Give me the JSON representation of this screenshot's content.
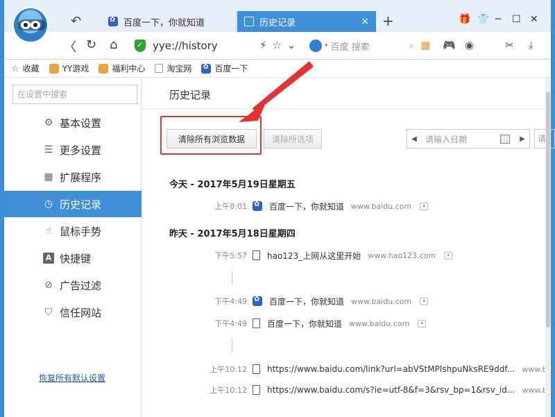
{
  "tabs": [
    {
      "title": "百度一下，你就知道",
      "icon": "baidu-paw-icon"
    },
    {
      "title": "历史记录",
      "icon": "page-icon",
      "close": "×"
    }
  ],
  "new_tab": "+",
  "window_controls": [
    "─",
    "☐",
    "✕"
  ],
  "title_icons": [
    "🎁",
    "👕"
  ],
  "nav": {
    "back": "〈",
    "refresh": "↻",
    "home": "⌂",
    "url": "yye://history",
    "undo": "↶"
  },
  "addr_icons": "⚡☆⌄",
  "search": {
    "placeholder": "百度 搜索",
    "dropdown": "▾"
  },
  "toolbar_icons": [
    "▦",
    "🎮",
    "◉",
    "✂",
    "⤓"
  ],
  "bookmarks": [
    {
      "label": "收藏",
      "icon": "star-icon"
    },
    {
      "label": "YY游戏",
      "icon": "tiger-icon"
    },
    {
      "label": "福利中心",
      "icon": "tiger-icon"
    },
    {
      "label": "淘宝网",
      "icon": "page-icon"
    },
    {
      "label": "百度一下",
      "icon": "baidu-paw-icon"
    }
  ],
  "sidebar": {
    "search_placeholder": "在设置中搜索",
    "items": [
      {
        "label": "基本设置",
        "icon": "⚙"
      },
      {
        "label": "更多设置",
        "icon": "☰"
      },
      {
        "label": "扩展程序",
        "icon": "▦"
      },
      {
        "label": "历史记录",
        "icon": "◷",
        "active": true
      },
      {
        "label": "鼠标手势",
        "icon": "☝"
      },
      {
        "label": "快捷键",
        "icon": "A"
      },
      {
        "label": "广告过滤",
        "icon": "⊘"
      },
      {
        "label": "信任网站",
        "icon": "⛉"
      }
    ],
    "restore_link": "恢复所有默认设置"
  },
  "main": {
    "title": "历史记录",
    "clear_all_button": "清除所有浏览数据",
    "clear_selected_button": "清除所选项",
    "date_placeholder": "请输入日期",
    "date_cut": "请",
    "arrow_left": "◀",
    "arrow_right": "▶",
    "dropdown_glyph": "▾",
    "days": [
      {
        "heading": "今天 - 2017年5月19日星期五",
        "entries": [
          {
            "time": "上午8:01",
            "title": "百度一下，你就知道",
            "domain": "www.baidu.com",
            "icon": "baidu-paw-icon"
          }
        ]
      },
      {
        "heading": "昨天 - 2017年5月18日星期四",
        "entries": [
          {
            "time": "下午5:57",
            "title": "hao123_上网从这里开始",
            "domain": "www.hao123.com",
            "icon": "page-icon"
          },
          {
            "time": "下午4:49",
            "title": "百度一下，你就知道",
            "domain": "www.baidu.com",
            "icon": "baidu-paw-icon"
          },
          {
            "time": "下午4:49",
            "title": "百度一下，你就知道",
            "domain": "www.baidu.com",
            "icon": "page-icon"
          },
          {
            "time": "上午10:12",
            "title": "https://www.baidu.com/link?url=abVStMPIshpuNksRE9ddf...",
            "domain": "www.baidu",
            "icon": "page-icon"
          },
          {
            "time": "上午10:12",
            "title": "https://www.baidu.com/s?ie=utf-8&f=3&rsv_bp=1&rsv_id...",
            "domain": "www.baidu",
            "icon": "page-icon"
          }
        ]
      }
    ]
  },
  "colors": {
    "accent": "#3f8fd8",
    "highlight": "#e53131",
    "background": "#3b8fd6"
  }
}
